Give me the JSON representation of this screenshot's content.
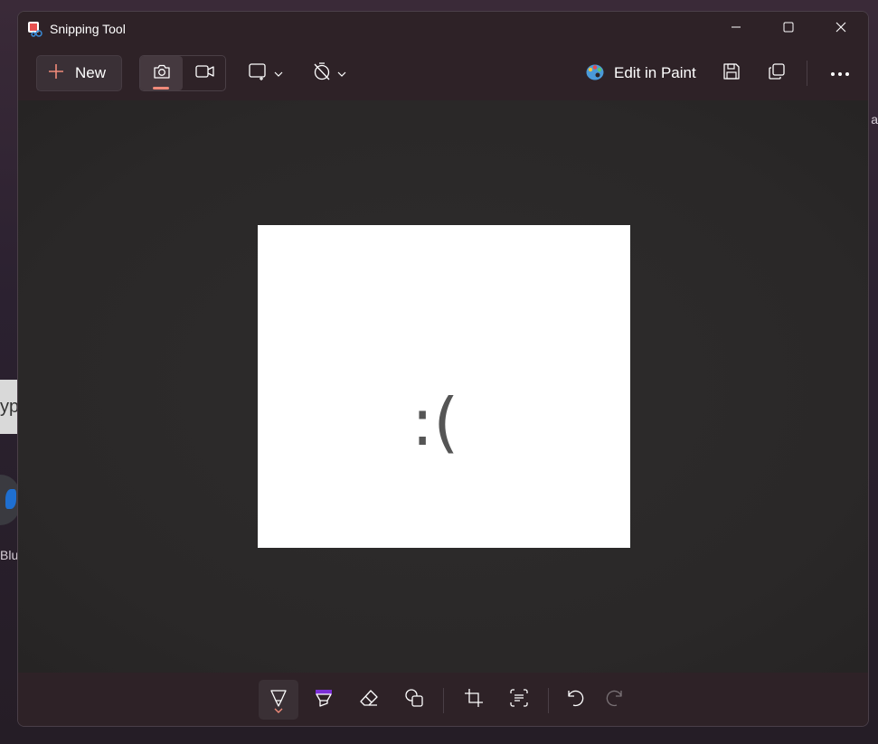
{
  "window": {
    "title": "Snipping Tool",
    "controls": {
      "minimize_icon": "minimize-icon",
      "maximize_icon": "maximize-icon",
      "close_icon": "close-icon"
    }
  },
  "toolbar": {
    "new_label": "New",
    "modes": [
      {
        "name": "snip",
        "icon": "camera-icon",
        "selected": true
      },
      {
        "name": "record",
        "icon": "video-icon",
        "selected": false
      }
    ],
    "shape_icon": "rectangle-snip-icon",
    "timer_icon": "no-delay-timer-icon",
    "edit_in_paint_label": "Edit in Paint",
    "save_icon": "save-icon",
    "copy_icon": "copy-icon",
    "more_icon": "more-icon"
  },
  "snip": {
    "content": ":("
  },
  "bottom_toolbar": {
    "tools": [
      {
        "name": "ballpoint-pen",
        "icon": "pen-icon",
        "selected": true
      },
      {
        "name": "highlighter",
        "icon": "highlighter-icon"
      },
      {
        "name": "eraser",
        "icon": "eraser-icon"
      },
      {
        "name": "shapes",
        "icon": "shapes-icon"
      },
      {
        "name": "crop",
        "icon": "crop-icon"
      },
      {
        "name": "text-actions",
        "icon": "text-actions-icon"
      },
      {
        "name": "undo",
        "icon": "undo-icon"
      },
      {
        "name": "redo",
        "icon": "redo-icon",
        "disabled": true
      }
    ]
  },
  "background": {
    "left_fragment_1": "yp",
    "left_fragment_2": "Blu",
    "right_fragment": "a"
  },
  "colors": {
    "accent": "#f08a7a",
    "highlighter": "#7b2fd6",
    "window_bg": "#2e2227",
    "canvas_bg": "#2c2a2a"
  }
}
